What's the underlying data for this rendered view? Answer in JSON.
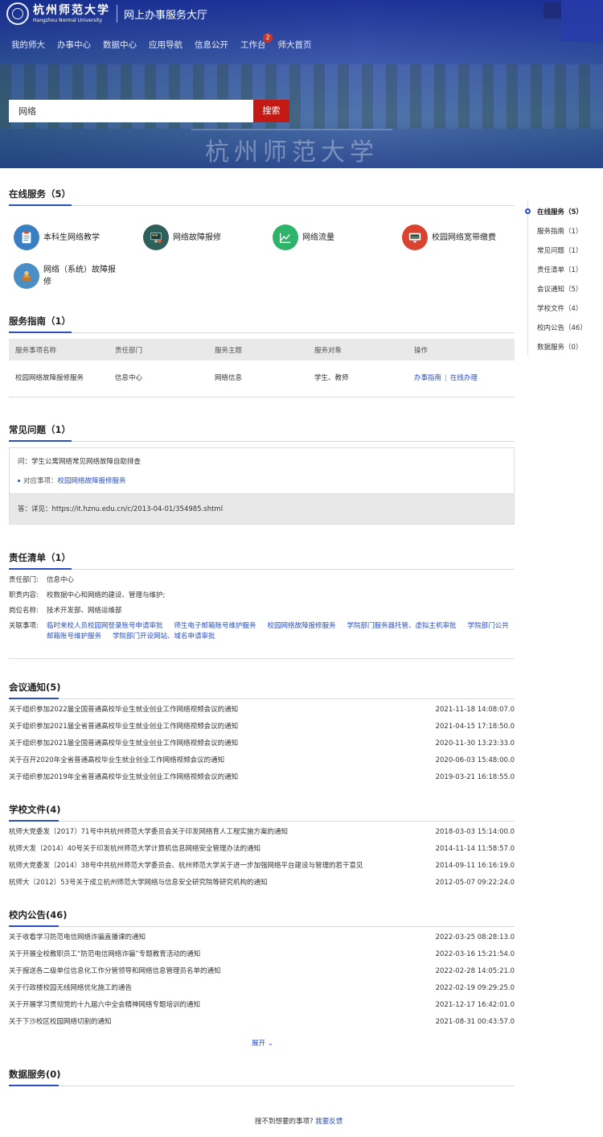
{
  "header": {
    "logo_cn": "杭州师范大学",
    "logo_en": "Hangzhou Normal University",
    "portal_title": "网上办事服务大厅",
    "hero_sign_text": "杭州师范大学",
    "nav": [
      {
        "label": "我的师大"
      },
      {
        "label": "办事中心"
      },
      {
        "label": "数据中心"
      },
      {
        "label": "应用导航"
      },
      {
        "label": "信息公开"
      },
      {
        "label": "工作台",
        "badge": "2"
      },
      {
        "label": "师大首页"
      }
    ],
    "search": {
      "value": "网络",
      "button": "搜索"
    }
  },
  "online_services": {
    "title": "在线服务（5）",
    "items": [
      {
        "label": "本科生网络教学",
        "icon": "clipboard-icon",
        "color": "#3a7fc4"
      },
      {
        "label": "网络故障报修",
        "icon": "computer-repair-icon",
        "color": "#2f5f5a"
      },
      {
        "label": "网络流量",
        "icon": "line-chart-icon",
        "color": "#2db36a"
      },
      {
        "label": "校园网络宽带缴费",
        "icon": "monitor-www-icon",
        "color": "#d8442f"
      },
      {
        "label": "网络（系统）故障报修",
        "icon": "repair-worker-icon",
        "color": "#4a8ec6"
      }
    ]
  },
  "guide": {
    "title": "服务指南（1）",
    "columns": [
      "服务事项名称",
      "责任部门",
      "服务主题",
      "服务对象",
      "操作"
    ],
    "rows": [
      {
        "name": "校园网络故障报修服务",
        "dept": "信息中心",
        "topic": "网络信息",
        "target": "学生、教师",
        "op1": "办事指南",
        "op2": "在线办理"
      }
    ]
  },
  "faq": {
    "title": "常见问题（1）",
    "question": "问：学生公寓网络常见网络故障自助排查",
    "related_label": "对应事项：",
    "related_link": "校园网络故障报修服务",
    "answer": "答：详见：https://it.hznu.edu.cn/c/2013-04-01/354985.shtml"
  },
  "duty": {
    "title": "责任清单（1）",
    "dept_label": "责任部门:",
    "dept": "信息中心",
    "content_label": "职责内容:",
    "content": "校数据中心和网络的建设、管理与维护;",
    "post_label": "岗位名称:",
    "post": "技术开发部、网络运维部",
    "related_label": "关联事项:",
    "related": [
      "临时来校人员校园网登录账号申请审批",
      "师生电子邮箱账号维护服务",
      "校园网络故障报修服务",
      "学院部门服务器托管、虚拟主机审批",
      "学院部门公共邮箱账号维护服务",
      "学院部门开设网站、域名申请审批"
    ]
  },
  "meetings": {
    "title": "会议通知(5)",
    "rows": [
      {
        "title": "关于组织参加2022届全国普通高校毕业生就业创业工作网络视频会议的通知",
        "date": "2021-11-18 14:08:07.0"
      },
      {
        "title": "关于组织参加2021届全省普通高校毕业生就业创业工作网络视频会议的通知",
        "date": "2021-04-15 17:18:50.0"
      },
      {
        "title": "关于组织参加2021届全国普通高校毕业生就业创业工作网络视频会议的通知",
        "date": "2020-11-30 13:23:33.0"
      },
      {
        "title": "关于召开2020年全省普通高校毕业生就业创业工作网络视频会议的通知",
        "date": "2020-06-03 15:48:00.0"
      },
      {
        "title": "关于组织参加2019年全省普通高校毕业生就业创业工作网络视频会议的通知",
        "date": "2019-03-21 16:18:55.0"
      }
    ]
  },
  "files": {
    "title": "学校文件(4)",
    "rows": [
      {
        "title": "杭师大党委发〔2017〕71号中共杭州师范大学委员会关于印发网络育人工程实施方案的通知",
        "date": "2018-03-03 15:14:00.0"
      },
      {
        "title": "杭师大发〔2014〕40号关于印发杭州师范大学计算机信息网络安全管理办法的通知",
        "date": "2014-11-14 11:58:57.0"
      },
      {
        "title": "杭师大党委发〔2014〕38号中共杭州师范大学委员会、杭州师范大学关于进一步加强网络平台建设与管理的若干意见",
        "date": "2014-09-11 16:16:19.0"
      },
      {
        "title": "杭师大〔2012〕53号关于成立杭州师范大学网络与信息安全研究院等研究机构的通知",
        "date": "2012-05-07 09:22:24.0"
      }
    ]
  },
  "notices": {
    "title": "校内公告(46)",
    "rows": [
      {
        "title": "关于收看学习防范电信网络诈骗直播课的通知",
        "date": "2022-03-25 08:28:13.0"
      },
      {
        "title": "关于开展全校教职员工“防范电信网络诈骗”专题教育活动的通知",
        "date": "2022-03-16 15:21:54.0"
      },
      {
        "title": "关于报送各二级单位信息化工作分管领导和网络信息管理员名单的通知",
        "date": "2022-02-28 14:05:21.0"
      },
      {
        "title": "关于行政楼校园无线网络优化施工的通告",
        "date": "2022-02-19 09:29:25.0"
      },
      {
        "title": "关于开展学习贯彻党的十九届六中全会精神网络专题培训的通知",
        "date": "2021-12-17 16:42:01.0"
      },
      {
        "title": "关于下沙校区校园网络切割的通知",
        "date": "2021-08-31 00:43:57.0"
      }
    ],
    "more": "展开 ⌄"
  },
  "data_services": {
    "title": "数据服务(0)"
  },
  "footer": {
    "text": "搜不到想要的事项?",
    "link": "我要反馈"
  },
  "side_nav": [
    {
      "label": "在线服务（5）"
    },
    {
      "label": "服务指南（1）"
    },
    {
      "label": "常见问题（1）"
    },
    {
      "label": "责任清单（1）"
    },
    {
      "label": "会议通知（5）"
    },
    {
      "label": "学校文件（4）"
    },
    {
      "label": "校内公告（46）"
    },
    {
      "label": "数据服务（0）"
    }
  ]
}
